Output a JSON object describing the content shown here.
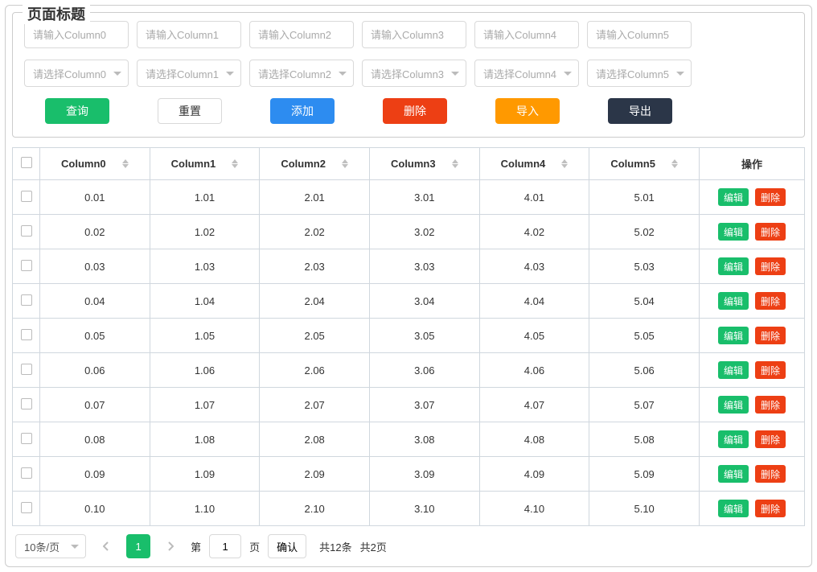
{
  "title": "页面标题",
  "filters": {
    "inputs": [
      {
        "placeholder": "请输入Column0"
      },
      {
        "placeholder": "请输入Column1"
      },
      {
        "placeholder": "请输入Column2"
      },
      {
        "placeholder": "请输入Column3"
      },
      {
        "placeholder": "请输入Column4"
      },
      {
        "placeholder": "请输入Column5"
      }
    ],
    "selects": [
      {
        "placeholder": "请选择Column0"
      },
      {
        "placeholder": "请选择Column1"
      },
      {
        "placeholder": "请选择Column2"
      },
      {
        "placeholder": "请选择Column3"
      },
      {
        "placeholder": "请选择Column4"
      },
      {
        "placeholder": "请选择Column5"
      }
    ]
  },
  "actions": {
    "query": "查询",
    "reset": "重置",
    "add": "添加",
    "delete": "删除",
    "import": "导入",
    "export": "导出"
  },
  "table": {
    "columns": [
      "Column0",
      "Column1",
      "Column2",
      "Column3",
      "Column4",
      "Column5"
    ],
    "action_header": "操作",
    "row_edit": "编辑",
    "row_delete": "删除",
    "rows": [
      [
        "0.01",
        "1.01",
        "2.01",
        "3.01",
        "4.01",
        "5.01"
      ],
      [
        "0.02",
        "1.02",
        "2.02",
        "3.02",
        "4.02",
        "5.02"
      ],
      [
        "0.03",
        "1.03",
        "2.03",
        "3.03",
        "4.03",
        "5.03"
      ],
      [
        "0.04",
        "1.04",
        "2.04",
        "3.04",
        "4.04",
        "5.04"
      ],
      [
        "0.05",
        "1.05",
        "2.05",
        "3.05",
        "4.05",
        "5.05"
      ],
      [
        "0.06",
        "1.06",
        "2.06",
        "3.06",
        "4.06",
        "5.06"
      ],
      [
        "0.07",
        "1.07",
        "2.07",
        "3.07",
        "4.07",
        "5.07"
      ],
      [
        "0.08",
        "1.08",
        "2.08",
        "3.08",
        "4.08",
        "5.08"
      ],
      [
        "0.09",
        "1.09",
        "2.09",
        "3.09",
        "4.09",
        "5.09"
      ],
      [
        "0.10",
        "1.10",
        "2.10",
        "3.10",
        "4.10",
        "5.10"
      ]
    ]
  },
  "pagination": {
    "page_size_label": "10条/页",
    "current_page": "1",
    "word_di": "第",
    "word_ye": "页",
    "confirm": "确认",
    "total_items": "共12条",
    "total_pages": "共2页"
  }
}
